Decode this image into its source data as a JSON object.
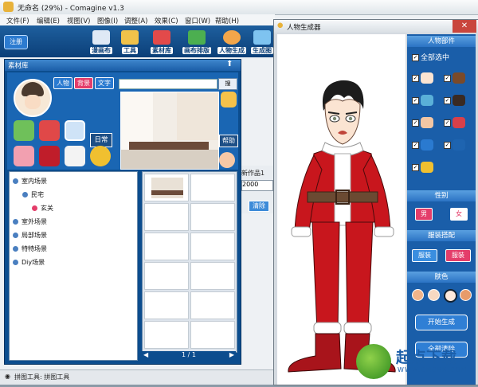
{
  "window": {
    "title": "无命名 (29%) - Comagine v1.3"
  },
  "menu": [
    "文件(F)",
    "编辑(E)",
    "视图(V)",
    "图像(I)",
    "调整(A)",
    "效果(C)",
    "窗口(W)",
    "帮助(H)"
  ],
  "toolbar": {
    "register": "注册",
    "canvas": "漫画布",
    "tools": "工具",
    "library": "素材库",
    "layout": "画布排版",
    "char_gen": "人物生成",
    "quick": "生成图"
  },
  "library": {
    "title": "素材库",
    "tabs": [
      "人物",
      "背景",
      "文字"
    ],
    "search_btn": "搜",
    "daily": "日常",
    "help": "帮助",
    "tree": [
      {
        "label": "室内场景",
        "level": 0
      },
      {
        "label": "民宅",
        "level": 1
      },
      {
        "label": "玄关",
        "level": 2
      },
      {
        "label": "室外场景",
        "level": 0
      },
      {
        "label": "局部场景",
        "level": 0
      },
      {
        "label": "特特场景",
        "level": 0
      },
      {
        "label": "Diy场景",
        "level": 0
      }
    ],
    "pager": "1 / 1"
  },
  "middle": {
    "label": "新作品1",
    "num": "2000",
    "clear": "清除"
  },
  "status": "拼图工具: 拼图工具",
  "dialog": {
    "title": "人物生成器",
    "parts_header": "人物部件",
    "select_all": "全部选中",
    "gender_header": "性别",
    "male": "男",
    "female": "女",
    "outfit_header": "服装搭配",
    "outfit_a": "服装",
    "outfit_b": "服装",
    "skin_header": "肤色",
    "skin_colors": [
      "#f1b48a",
      "#f7d9c2",
      "#fde9dc",
      "#e79b6a"
    ],
    "start": "开始生成",
    "clear_all": "全部清除"
  },
  "watermark": {
    "brand": "起点下载",
    "url": "WWW.CNCRK.COM"
  },
  "colors": {
    "toolbar": "#0b3f78",
    "panel": "#0c4d8e",
    "accent": "#e43d6a",
    "coat": "#c8161d"
  }
}
